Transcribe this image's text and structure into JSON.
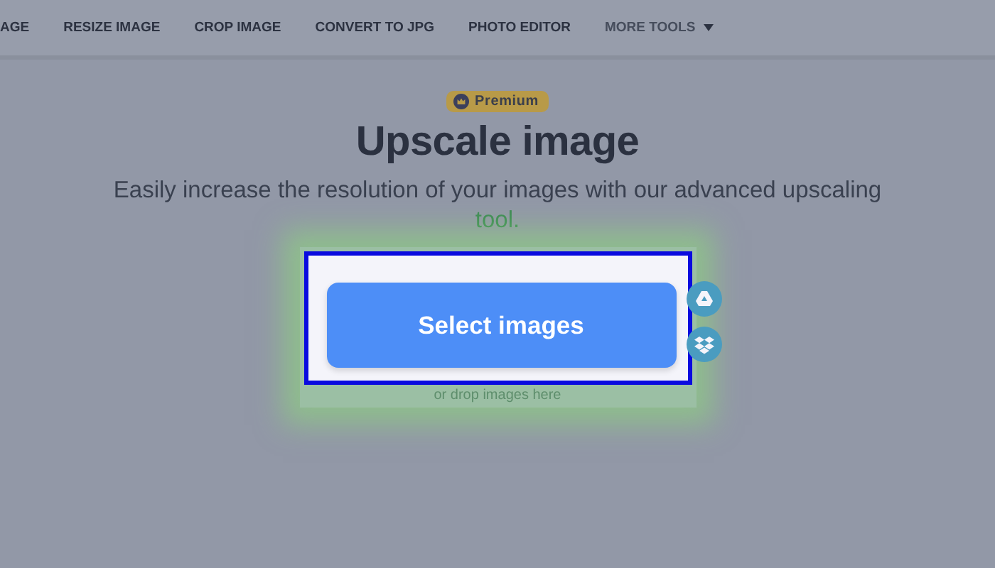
{
  "nav": {
    "items": [
      {
        "label": "AGE",
        "kind": "link"
      },
      {
        "label": "RESIZE IMAGE",
        "kind": "link"
      },
      {
        "label": "CROP IMAGE",
        "kind": "link"
      },
      {
        "label": "CONVERT TO JPG",
        "kind": "link"
      },
      {
        "label": "PHOTO EDITOR",
        "kind": "link"
      },
      {
        "label": "MORE TOOLS",
        "kind": "menu"
      }
    ]
  },
  "badge": "Premium",
  "title": "Upscale image",
  "description": {
    "text": "Easily increase the resolution of your images with our advanced upscaling",
    "link": "tool."
  },
  "upload": {
    "button": "Select images",
    "hint": "or drop images here"
  }
}
